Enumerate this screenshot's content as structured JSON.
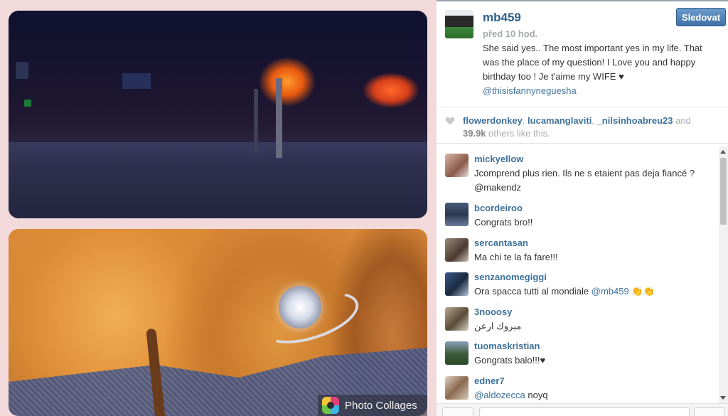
{
  "post": {
    "username": "mb459",
    "time": "před 10 hod.",
    "follow_label": "Sledovat",
    "caption": "She said yes.. The most important yes in my life. That was the place of my question! I Love you and happy birthday too ! Je t'aime my WIFE",
    "caption_heart": "♥",
    "caption_mention": "@thisisfannyneguesha"
  },
  "photo": {
    "collage_label": "Photo Collages"
  },
  "likes": {
    "user1": "flowerdonkey",
    "user2": "lucamanglaviti",
    "user3": "_nilsinhoabreu23",
    "and": "and",
    "count": "39.9k",
    "suffix": "others like this."
  },
  "comments": [
    {
      "user": "mickyellow",
      "text": "Jcomprend plus rien. Ils ne s etaient pas deja fiancé ?",
      "text2": "@makendz"
    },
    {
      "user": "bcordeiroo",
      "text": "Congrats bro!!"
    },
    {
      "user": "sercantasan",
      "text": "Ma chi te la fa fare!!!"
    },
    {
      "user": "senzanomegiggi",
      "text": "Ora spacca tutti al mondiale",
      "mention": "@mb459",
      "emoji": "👏👏"
    },
    {
      "user": "3nooosy",
      "text": "مبروك ارعن"
    },
    {
      "user": "tuomaskristian",
      "text": "Gongrats balo!!!♥"
    },
    {
      "user": "edner7",
      "mention": "@aldozecca",
      "text": " noyq"
    }
  ],
  "colors": {
    "link": "#3f729b",
    "follow": "#3f72a8"
  }
}
